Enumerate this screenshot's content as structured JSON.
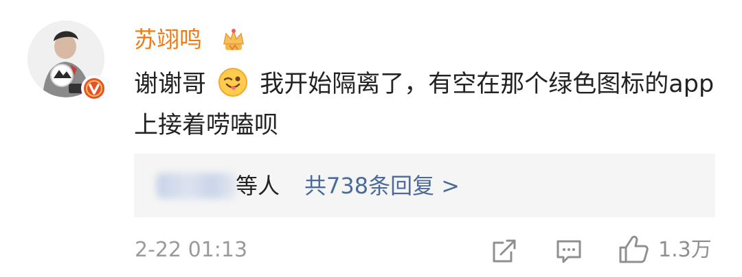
{
  "comment": {
    "author": "苏翊鸣",
    "text_before_emoji": "谢谢哥",
    "emoji_icon": "tongue-wink-emoji-icon",
    "text_after_emoji": "我开始隔离了，有空在那个绿色图标的app上接着唠嗑呗",
    "author_badge_icon": "crown-icon",
    "verified_badge_icon": "verified-v-icon"
  },
  "replies": {
    "others_label": "等人",
    "summary_link": "共738条回复 >"
  },
  "footer": {
    "timestamp": "2-22 01:13",
    "like_count": "1.3万",
    "share_icon": "share-icon",
    "comment_icon": "comment-icon",
    "like_icon": "thumbs-up-icon"
  },
  "colors": {
    "username": "#f07a13",
    "link": "#4a6a9a",
    "muted": "#9a9a9a",
    "reply_box": "#f5f5f5",
    "verified_badge": "#e8502d"
  }
}
